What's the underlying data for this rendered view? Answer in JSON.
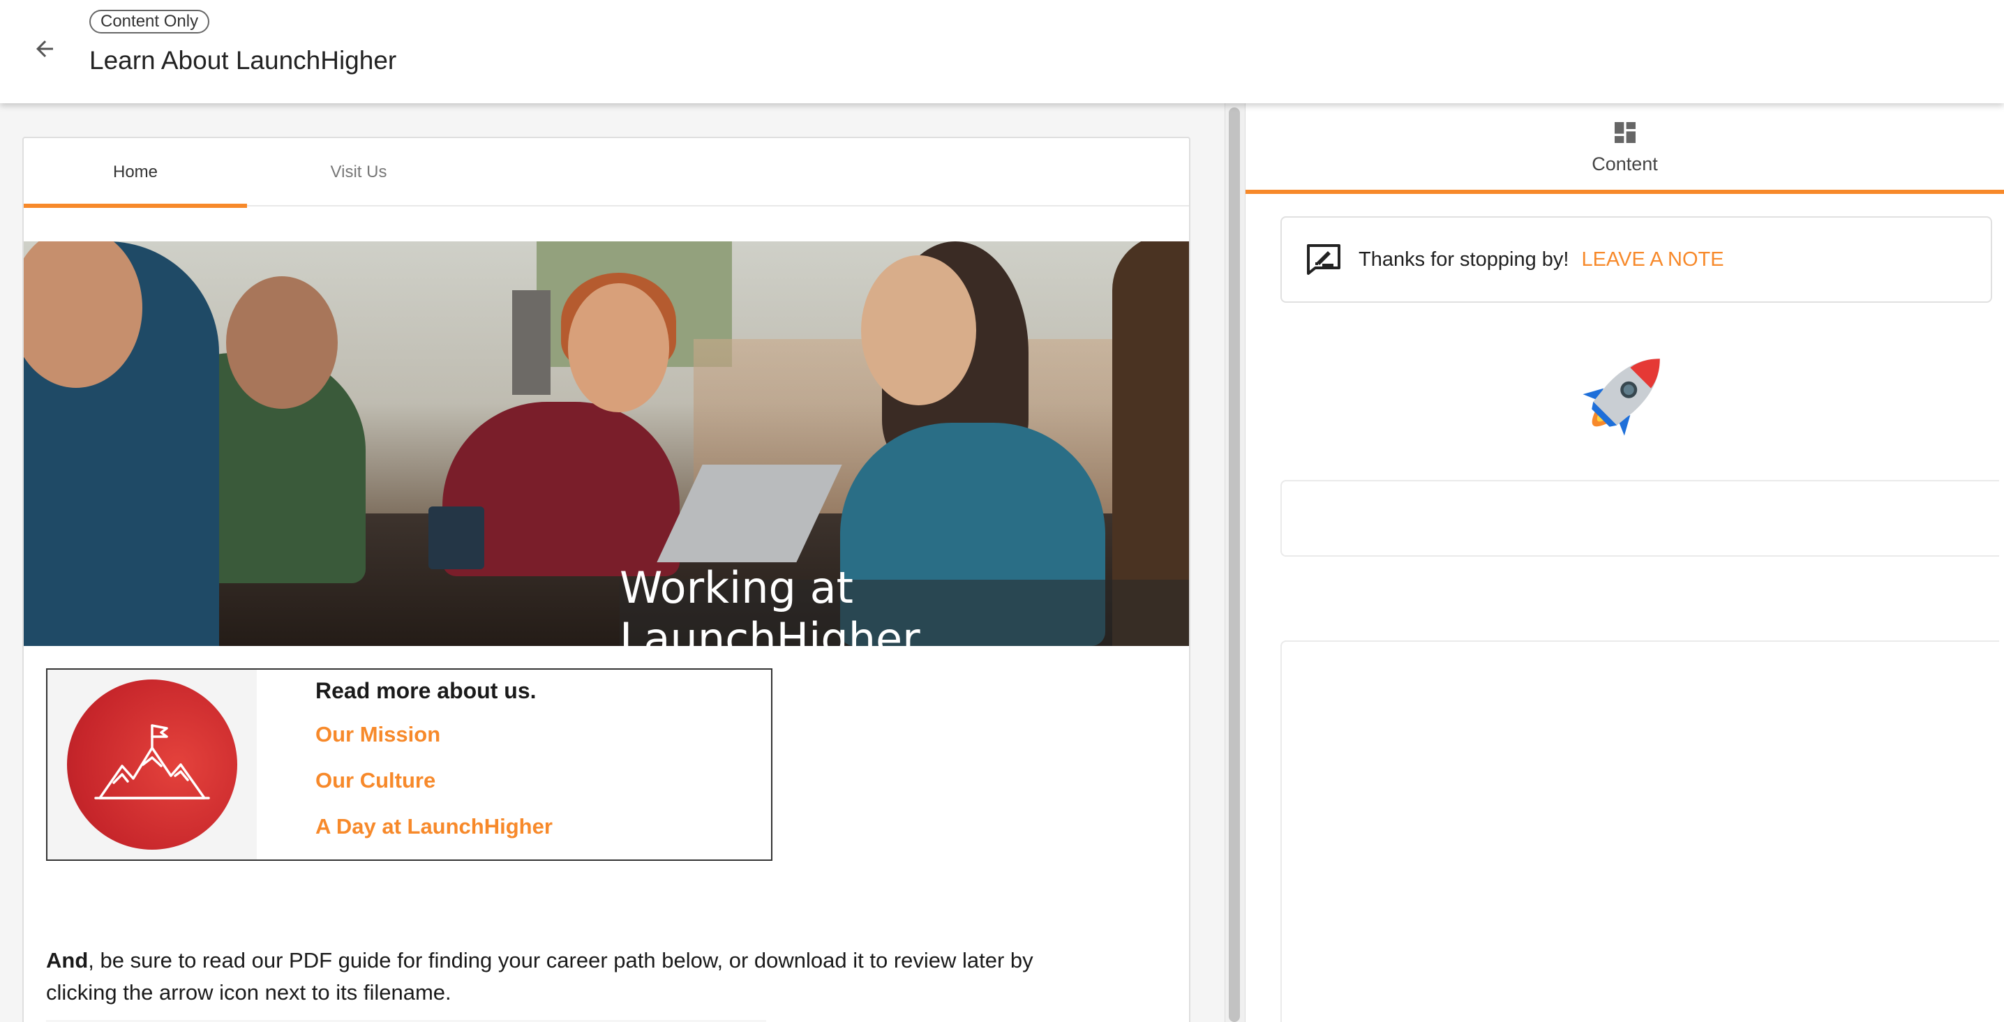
{
  "header": {
    "badge": "Content Only",
    "title": "Learn About LaunchHigher"
  },
  "tabs": [
    {
      "label": "Home",
      "active": true
    },
    {
      "label": "Visit Us",
      "active": false
    }
  ],
  "hero": {
    "caption": "Working at LaunchHigher"
  },
  "promo": {
    "heading": "Read more about us.",
    "links": [
      "Our Mission",
      "Our Culture",
      "A Day at LaunchHigher"
    ]
  },
  "body": {
    "bold_lead": "And",
    "text": ", be sure to read our PDF guide for finding your career path below, or download it to review later by clicking the arrow icon next to its filename."
  },
  "right_panel": {
    "tab_label": "Content",
    "note_text": "Thanks for stopping by!",
    "note_link": "LEAVE A NOTE"
  },
  "colors": {
    "accent": "#f7892a",
    "logo_red": "#d32f2f"
  },
  "icons": [
    "back-arrow-icon",
    "dashboard-icon",
    "note-edit-icon",
    "rocket-icon",
    "mountain-flag-icon"
  ]
}
